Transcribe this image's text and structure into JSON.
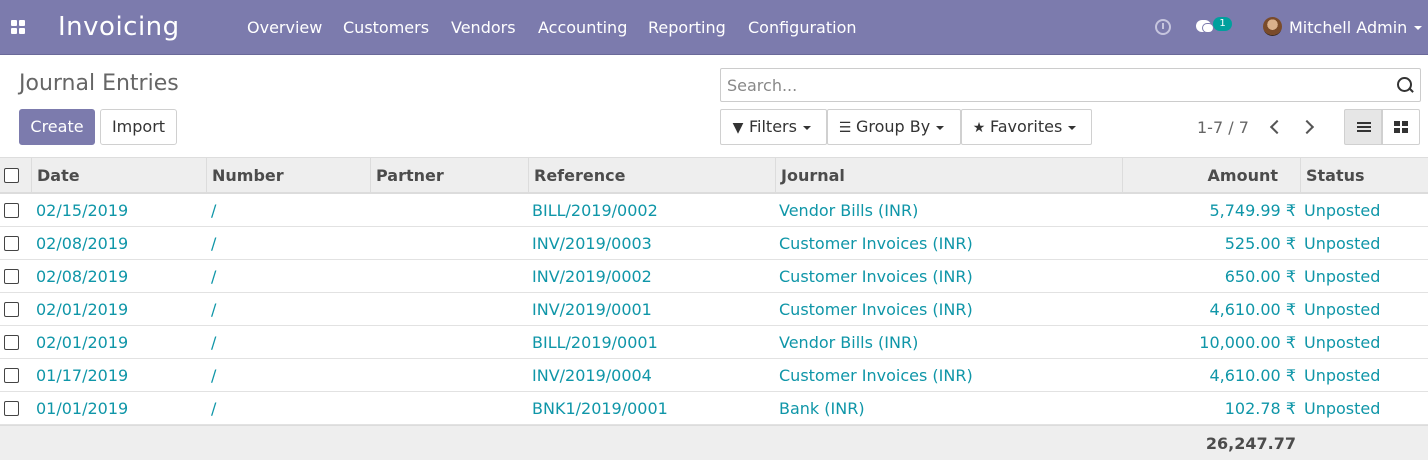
{
  "navbar": {
    "app_title": "Invoicing",
    "menu": [
      "Overview",
      "Customers",
      "Vendors",
      "Accounting",
      "Reporting",
      "Configuration"
    ],
    "chat_count": "1",
    "user_name": "Mitchell Admin",
    "bg_color": "#7c7bad",
    "badge_color": "#00a09d"
  },
  "control_panel": {
    "breadcrumb": "Journal Entries",
    "create_label": "Create",
    "import_label": "Import",
    "search_placeholder": "Search...",
    "filters_label": "Filters",
    "groupby_label": "Group By",
    "favorites_label": "Favorites",
    "pager_text": "1-7 / 7"
  },
  "table": {
    "columns": {
      "date": "Date",
      "number": "Number",
      "partner": "Partner",
      "reference": "Reference",
      "journal": "Journal",
      "amount": "Amount",
      "status": "Status"
    },
    "rows": [
      {
        "date": "02/15/2019",
        "number": "/",
        "partner": "",
        "reference": "BILL/2019/0002",
        "journal": "Vendor Bills (INR)",
        "amount": "5,749.99 ₹",
        "status": "Unposted"
      },
      {
        "date": "02/08/2019",
        "number": "/",
        "partner": "",
        "reference": "INV/2019/0003",
        "journal": "Customer Invoices (INR)",
        "amount": "525.00 ₹",
        "status": "Unposted"
      },
      {
        "date": "02/08/2019",
        "number": "/",
        "partner": "",
        "reference": "INV/2019/0002",
        "journal": "Customer Invoices (INR)",
        "amount": "650.00 ₹",
        "status": "Unposted"
      },
      {
        "date": "02/01/2019",
        "number": "/",
        "partner": "",
        "reference": "INV/2019/0001",
        "journal": "Customer Invoices (INR)",
        "amount": "4,610.00 ₹",
        "status": "Unposted"
      },
      {
        "date": "02/01/2019",
        "number": "/",
        "partner": "",
        "reference": "BILL/2019/0001",
        "journal": "Vendor Bills (INR)",
        "amount": "10,000.00 ₹",
        "status": "Unposted"
      },
      {
        "date": "01/17/2019",
        "number": "/",
        "partner": "",
        "reference": "INV/2019/0004",
        "journal": "Customer Invoices (INR)",
        "amount": "4,610.00 ₹",
        "status": "Unposted"
      },
      {
        "date": "01/01/2019",
        "number": "/",
        "partner": "",
        "reference": "BNK1/2019/0001",
        "journal": "Bank (INR)",
        "amount": "102.78 ₹",
        "status": "Unposted"
      }
    ],
    "total_amount": "26,247.77",
    "link_color": "#0f96a8"
  }
}
